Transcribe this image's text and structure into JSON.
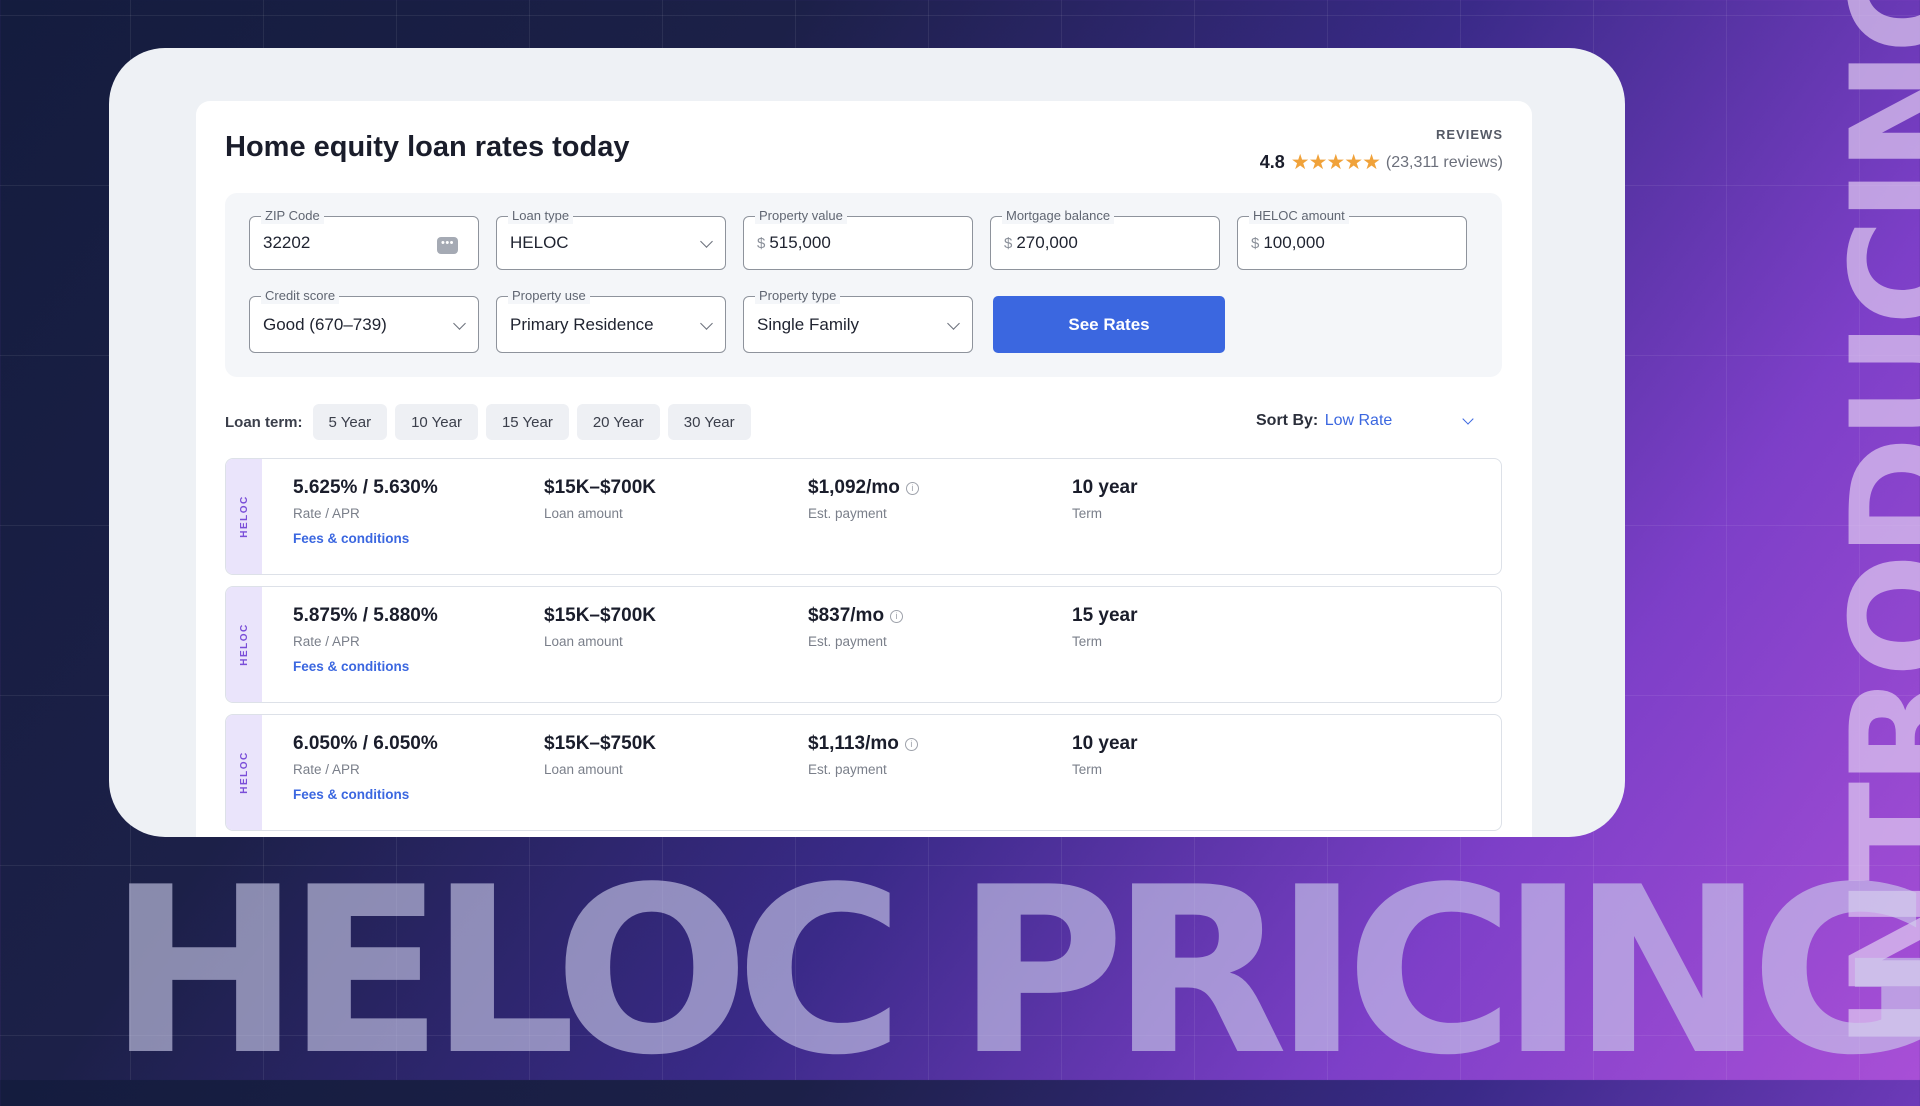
{
  "banner": {
    "vertical_text": "INTRODUCING",
    "big_text": "HELOC PRICING"
  },
  "card": {
    "title": "Home equity loan rates today",
    "reviews": {
      "label": "REVIEWS",
      "score": "4.8",
      "stars": "★★★★★",
      "count": "(23,311 reviews)"
    }
  },
  "form": {
    "zip": {
      "label": "ZIP Code",
      "value": "32202"
    },
    "loan_type": {
      "label": "Loan type",
      "value": "HELOC"
    },
    "property_value": {
      "label": "Property value",
      "prefix": "$",
      "value": "515,000"
    },
    "mortgage_balance": {
      "label": "Mortgage balance",
      "prefix": "$",
      "value": "270,000"
    },
    "heloc_amount": {
      "label": "HELOC amount",
      "prefix": "$",
      "value": "100,000"
    },
    "credit_score": {
      "label": "Credit score",
      "value": "Good (670–739)"
    },
    "property_use": {
      "label": "Property use",
      "value": "Primary Residence"
    },
    "property_type": {
      "label": "Property type",
      "value": "Single Family"
    },
    "submit_label": "See Rates"
  },
  "loan_term": {
    "label": "Loan term:",
    "options": [
      "5 Year",
      "10 Year",
      "15 Year",
      "20 Year",
      "30 Year"
    ]
  },
  "sort": {
    "label": "Sort By:",
    "value": "Low Rate"
  },
  "offers": [
    {
      "tag": "HELOC",
      "rate": "5.625% / 5.630%",
      "rate_label": "Rate / APR",
      "link": "Fees & conditions",
      "amount": "$15K–$700K",
      "amount_label": "Loan amount",
      "payment": "$1,092/mo",
      "payment_label": "Est. payment",
      "term": "10 year",
      "term_label": "Term"
    },
    {
      "tag": "HELOC",
      "rate": "5.875% / 5.880%",
      "rate_label": "Rate / APR",
      "link": "Fees & conditions",
      "amount": "$15K–$700K",
      "amount_label": "Loan amount",
      "payment": "$837/mo",
      "payment_label": "Est. payment",
      "term": "15 year",
      "term_label": "Term"
    },
    {
      "tag": "HELOC",
      "rate": "6.050% / 6.050%",
      "rate_label": "Rate / APR",
      "link": "Fees & conditions",
      "amount": "$15K–$750K",
      "amount_label": "Loan amount",
      "payment": "$1,113/mo",
      "payment_label": "Est. payment",
      "term": "10 year",
      "term_label": "Term"
    }
  ],
  "colors": {
    "accent": "#3b67e0",
    "star": "#f0a23a",
    "heloc_tag": "#7a4ed8"
  }
}
